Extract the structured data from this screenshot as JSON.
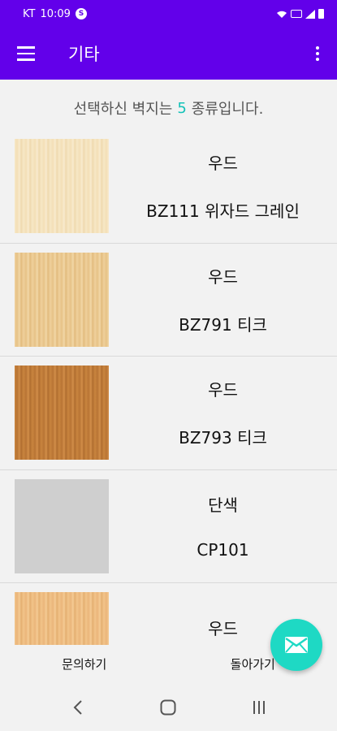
{
  "status": {
    "carrier": "KT",
    "time": "10:09",
    "badge": "S"
  },
  "app_bar": {
    "title": "기타",
    "menu_icon": "hamburger-icon",
    "more_icon": "more-vert-icon"
  },
  "summary": {
    "prefix": "선택하신 벽지는",
    "count": "5",
    "suffix": "종류입니다."
  },
  "items": [
    {
      "category": "우드",
      "name": "BZ111 위자드 그레인"
    },
    {
      "category": "우드",
      "name": "BZ791 티크"
    },
    {
      "category": "우드",
      "name": "BZ793 티크"
    },
    {
      "category": "단색",
      "name": "CP101"
    },
    {
      "category": "우드",
      "name": ""
    }
  ],
  "actions": {
    "inquiry": "문의하기",
    "back": "돌아가기"
  },
  "fab": {
    "icon": "mail-icon",
    "color": "#1ed9c4"
  },
  "theme": {
    "primary": "#6200ea",
    "accent": "#14c2b8"
  }
}
